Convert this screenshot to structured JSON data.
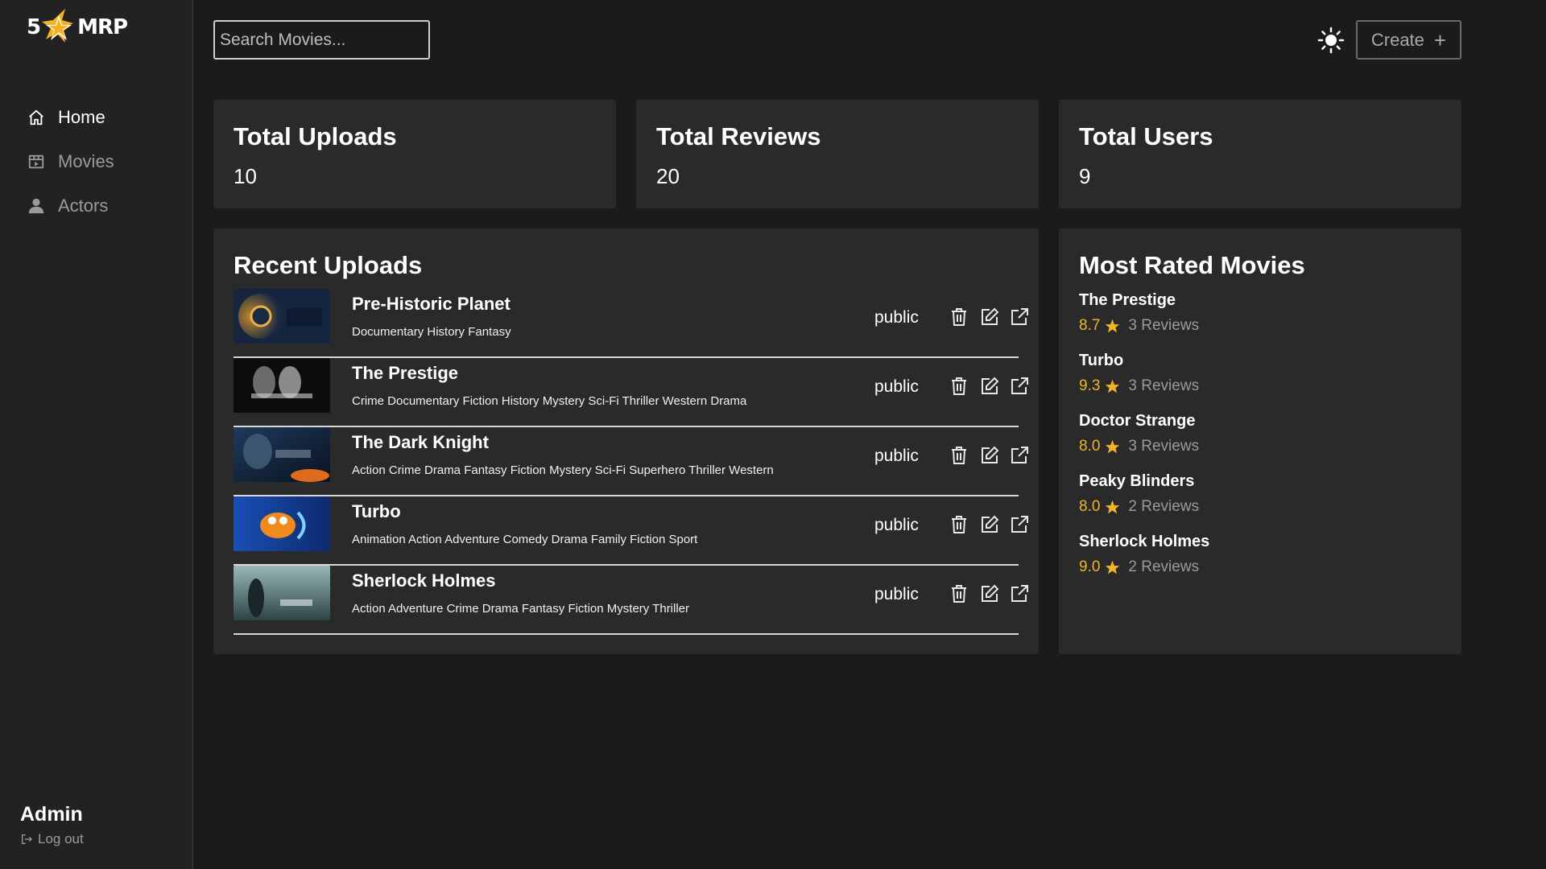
{
  "app": {
    "logo_number": "5",
    "logo_text": "MRP"
  },
  "sidebar": {
    "items": [
      {
        "label": "Home",
        "icon": "home-icon",
        "active": true
      },
      {
        "label": "Movies",
        "icon": "film-icon",
        "active": false
      },
      {
        "label": "Actors",
        "icon": "user-icon",
        "active": false
      }
    ],
    "user_name": "Admin",
    "logout_label": "Log out"
  },
  "header": {
    "search_placeholder": "Search Movies...",
    "create_label": "Create",
    "theme_icon": "sun-icon"
  },
  "stats": [
    {
      "title": "Total Uploads",
      "value": "10"
    },
    {
      "title": "Total Reviews",
      "value": "20"
    },
    {
      "title": "Total Users",
      "value": "9"
    }
  ],
  "recent": {
    "title": "Recent Uploads",
    "items": [
      {
        "title": "Pre-Historic Planet",
        "genres": "Documentary History Fantasy",
        "status": "public",
        "thumb": "poster-prehistoric-planet"
      },
      {
        "title": "The Prestige",
        "genres": "Crime Documentary Fiction History Mystery Sci-Fi Thriller Western Drama",
        "status": "public",
        "thumb": "poster-the-prestige"
      },
      {
        "title": "The Dark Knight",
        "genres": "Action Crime Drama Fantasy Fiction Mystery Sci-Fi Superhero Thriller Western",
        "status": "public",
        "thumb": "poster-the-dark-knight"
      },
      {
        "title": "Turbo",
        "genres": "Animation Action Adventure Comedy Drama Family Fiction Sport",
        "status": "public",
        "thumb": "poster-turbo"
      },
      {
        "title": "Sherlock Holmes",
        "genres": "Action Adventure Crime Drama Fantasy Fiction Mystery Thriller",
        "status": "public",
        "thumb": "poster-sherlock-holmes"
      }
    ]
  },
  "most_rated": {
    "title": "Most Rated Movies",
    "items": [
      {
        "title": "The Prestige",
        "rating": "8.7",
        "reviews": "3 Reviews"
      },
      {
        "title": "Turbo",
        "rating": "9.3",
        "reviews": "3 Reviews"
      },
      {
        "title": "Doctor Strange",
        "rating": "8.0",
        "reviews": "3 Reviews"
      },
      {
        "title": "Peaky Blinders",
        "rating": "8.0",
        "reviews": "2 Reviews"
      },
      {
        "title": "Sherlock Holmes",
        "rating": "9.0",
        "reviews": "2 Reviews"
      }
    ]
  },
  "colors": {
    "background": "#1b1b1b",
    "sidebar": "#222222",
    "card": "#2a2a2a",
    "accent_rating": "#f0b429",
    "muted_text": "#9a9a9a"
  }
}
